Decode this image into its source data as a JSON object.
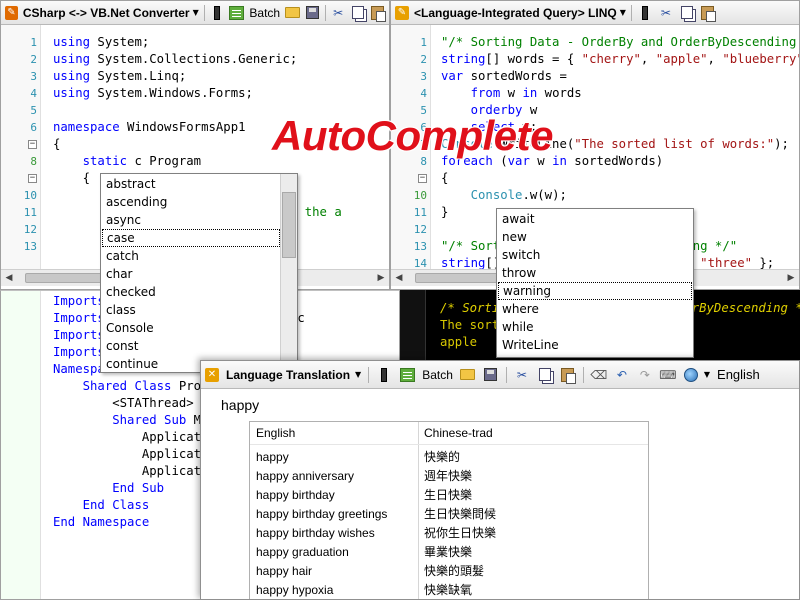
{
  "csharp_panel": {
    "title": "CSharp <-> VB.Net Converter",
    "batch_label": "Batch",
    "lines": [
      {
        "n": "1",
        "tokens": [
          {
            "t": "using",
            "c": "kw"
          },
          {
            "t": " System;"
          }
        ]
      },
      {
        "n": "2",
        "tokens": [
          {
            "t": "using",
            "c": "kw"
          },
          {
            "t": " System.Collections.Generic;"
          }
        ]
      },
      {
        "n": "3",
        "tokens": [
          {
            "t": "using",
            "c": "kw"
          },
          {
            "t": " System.Linq;"
          }
        ]
      },
      {
        "n": "4",
        "tokens": [
          {
            "t": "using",
            "c": "kw"
          },
          {
            "t": " System.Windows.Forms;"
          }
        ]
      },
      {
        "n": "5",
        "tokens": []
      },
      {
        "n": "6",
        "tokens": [
          {
            "t": "namespace",
            "c": "kw"
          },
          {
            "t": " WindowsFormsApp1"
          }
        ]
      },
      {
        "n": "7",
        "tokens": [
          {
            "t": "{"
          }
        ]
      },
      {
        "n": "8",
        "tokens": [
          {
            "t": "    "
          },
          {
            "t": "static",
            "c": "kw"
          },
          {
            "t": " c Program"
          }
        ]
      },
      {
        "n": "9",
        "tokens": [
          {
            "t": "    {"
          }
        ]
      },
      {
        "n": "10",
        "tokens": []
      },
      {
        "n": "11",
        "tokens": [
          {
            "t": "                            "
          },
          {
            "t": "t for the a",
            "c": "com"
          }
        ]
      },
      {
        "n": "12",
        "tokens": []
      },
      {
        "n": "13",
        "tokens": []
      }
    ],
    "autocomplete": [
      "abstract",
      "ascending",
      "async",
      "case",
      "catch",
      "char",
      "checked",
      "class",
      "Console",
      "const",
      "continue"
    ],
    "autocomplete_selected": "case"
  },
  "vb_code": {
    "lines": [
      {
        "tokens": [
          {
            "t": "Imports",
            "c": "kw"
          },
          {
            "t": " System"
          }
        ]
      },
      {
        "tokens": [
          {
            "t": "Imports",
            "c": "kw"
          },
          {
            "t": " System.Collections.Generic"
          }
        ]
      },
      {
        "tokens": [
          {
            "t": "Imports",
            "c": "kw"
          },
          {
            "t": " System.Linq"
          }
        ]
      },
      {
        "tokens": [
          {
            "t": "Imports",
            "c": "kw"
          },
          {
            "t": " System.Windows.Forms"
          }
        ]
      },
      {
        "tokens": [
          {
            "t": "Namespace",
            "c": "kw"
          },
          {
            "t": " WindowsFormsApp1"
          }
        ]
      },
      {
        "tokens": [
          {
            "t": "    "
          },
          {
            "t": "Shared Class",
            "c": "kw"
          },
          {
            "t": " Program"
          }
        ]
      },
      {
        "tokens": [
          {
            "t": "        <STAThread>"
          }
        ]
      },
      {
        "tokens": [
          {
            "t": "        "
          },
          {
            "t": "Shared Sub",
            "c": "kw"
          },
          {
            "t": " Main()"
          }
        ]
      },
      {
        "tokens": [
          {
            "t": "            Application.EnableVisualStyles()"
          }
        ]
      },
      {
        "tokens": [
          {
            "t": "            Application.SetCompatibleTextRenderingDefault(False)"
          }
        ]
      },
      {
        "tokens": [
          {
            "t": "            Application.Run(New Form1())"
          }
        ]
      },
      {
        "tokens": [
          {
            "t": "        "
          },
          {
            "t": "End Sub",
            "c": "kw"
          }
        ]
      },
      {
        "tokens": [
          {
            "t": "    "
          },
          {
            "t": "End Class",
            "c": "kw"
          }
        ]
      },
      {
        "tokens": [
          {
            "t": "End Namespace",
            "c": "kw"
          }
        ]
      }
    ]
  },
  "linq_panel": {
    "title": "<Language-Integrated Query> LINQ",
    "lines": [
      {
        "n": "1",
        "tokens": [
          {
            "t": "\"/* Sorting Data - OrderBy and OrderByDescending */\"",
            "c": "com"
          }
        ]
      },
      {
        "n": "2",
        "tokens": [
          {
            "t": "string",
            "c": "kw"
          },
          {
            "t": "[] words = { "
          },
          {
            "t": "\"cherry\"",
            "c": "str"
          },
          {
            "t": ", "
          },
          {
            "t": "\"apple\"",
            "c": "str"
          },
          {
            "t": ", "
          },
          {
            "t": "\"blueberry\"",
            "c": "str"
          },
          {
            "t": " };"
          }
        ]
      },
      {
        "n": "3",
        "tokens": [
          {
            "t": "var",
            "c": "kw"
          },
          {
            "t": " sortedWords ="
          }
        ]
      },
      {
        "n": "4",
        "tokens": [
          {
            "t": "    "
          },
          {
            "t": "from",
            "c": "kw"
          },
          {
            "t": " w "
          },
          {
            "t": "in",
            "c": "kw"
          },
          {
            "t": " words"
          }
        ]
      },
      {
        "n": "5",
        "tokens": [
          {
            "t": "    "
          },
          {
            "t": "orderby",
            "c": "kw"
          },
          {
            "t": " w"
          }
        ]
      },
      {
        "n": "6",
        "tokens": [
          {
            "t": "    "
          },
          {
            "t": "select",
            "c": "kw"
          },
          {
            "t": " w;"
          }
        ]
      },
      {
        "n": "7",
        "tokens": [
          {
            "t": "Console",
            "c": "type"
          },
          {
            "t": ".WriteLine("
          },
          {
            "t": "\"The sorted list of words:\"",
            "c": "str"
          },
          {
            "t": ");"
          }
        ]
      },
      {
        "n": "8",
        "tokens": [
          {
            "t": "foreach",
            "c": "kw"
          },
          {
            "t": " ("
          },
          {
            "t": "var",
            "c": "kw"
          },
          {
            "t": " w "
          },
          {
            "t": "in",
            "c": "kw"
          },
          {
            "t": " sortedWords)"
          }
        ]
      },
      {
        "n": "9",
        "tokens": [
          {
            "t": "{"
          }
        ]
      },
      {
        "n": "10",
        "tokens": [
          {
            "t": "    "
          },
          {
            "t": "Console",
            "c": "type"
          },
          {
            "t": ".w(w);"
          }
        ]
      },
      {
        "n": "11",
        "tokens": [
          {
            "t": "}"
          }
        ]
      },
      {
        "n": "12",
        "tokens": []
      },
      {
        "n": "13",
        "tokens": [
          {
            "t": "\"/* Sorting Data - OrderByDescending */\"",
            "c": "com"
          }
        ]
      },
      {
        "n": "14",
        "tokens": [
          {
            "t": "string",
            "c": "kw"
          },
          {
            "t": "[] numbers = { "
          },
          {
            "t": "\"one\"",
            "c": "str"
          },
          {
            "t": ", "
          },
          {
            "t": "\"two\"",
            "c": "str"
          },
          {
            "t": ", "
          },
          {
            "t": "\"three\"",
            "c": "str"
          },
          {
            "t": " };"
          }
        ]
      }
    ],
    "autocomplete": [
      "await",
      "new",
      "switch",
      "throw",
      "warning",
      "where",
      "while",
      "WriteLine"
    ],
    "autocomplete_selected": "warning"
  },
  "dark_output": {
    "lines": [
      "/* Sorting Data - OrderBy and OrderByDescending */",
      "The sorted list of words:",
      "apple"
    ]
  },
  "overlay": {
    "title": "AutoComplete"
  },
  "translation_window": {
    "title": "Language Translation",
    "batch_label": "Batch",
    "language": "English",
    "input": "happy",
    "headers": [
      "English",
      "Chinese-trad"
    ],
    "rows": [
      [
        "happy",
        "快樂的"
      ],
      [
        "happy anniversary",
        "週年快樂"
      ],
      [
        "happy birthday",
        "生日快樂"
      ],
      [
        "happy birthday greetings",
        "生日快樂問候"
      ],
      [
        "happy birthday wishes",
        "祝你生日快樂"
      ],
      [
        "happy graduation",
        "畢業快樂"
      ],
      [
        "happy hair",
        "快樂的頭髮"
      ],
      [
        "happy hypoxia",
        "快樂缺氧"
      ]
    ]
  }
}
